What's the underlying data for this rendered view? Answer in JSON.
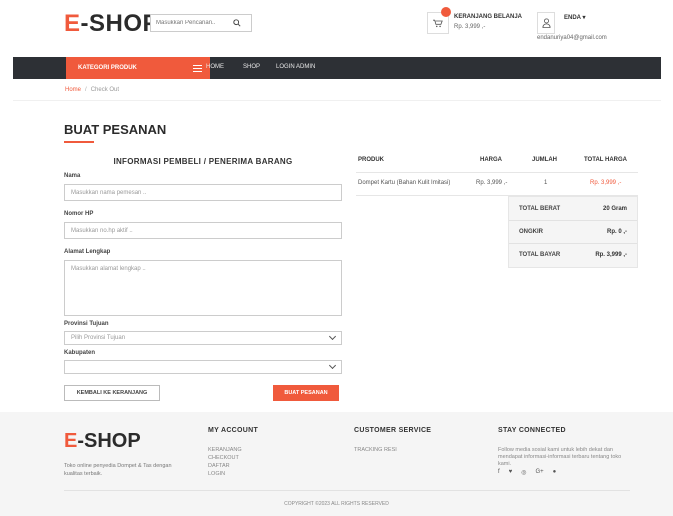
{
  "brand": {
    "prefix": "E",
    "suffix": "-SHOP",
    "accent": "#f05a3c",
    "dark": "#2d3035"
  },
  "search": {
    "placeholder": "Masukkan Pencarian..",
    "icon": "search-icon"
  },
  "cart": {
    "title": "KERANJANG BELANJA",
    "price": "Rp. 3,999 ,-",
    "icon": "cart-icon"
  },
  "user": {
    "name": "ENDA",
    "email": "endanuriya04@gmail.com",
    "icon": "user-icon"
  },
  "nav": {
    "category_label": "KATEGORI PRODUK",
    "links": [
      "HOME",
      "SHOP",
      "LOGIN ADMIN"
    ]
  },
  "breadcrumb": {
    "home": "Home",
    "separator": "/",
    "current": "Check Out"
  },
  "page": {
    "title": "BUAT PESANAN"
  },
  "form": {
    "heading": "INFORMASI PEMBELI / PENERIMA BARANG",
    "name_label": "Nama",
    "name_placeholder": "Masukkan nama pemesan ..",
    "phone_label": "Nomor HP",
    "phone_placeholder": "Masukkan no.hp aktif ..",
    "address_label": "Alamat Lengkap",
    "address_placeholder": "Masukkan alamat lengkap ..",
    "province_label": "Provinsi Tujuan",
    "province_value": "Pilih Provinsi Tujuan",
    "city_label": "Kabupaten",
    "city_value": "",
    "back_button": "KEMBALI KE KERANJANG",
    "order_button": "BUAT PESANAN"
  },
  "table": {
    "headers": [
      "PRODUK",
      "HARGA",
      "JUMLAH",
      "TOTAL HARGA"
    ],
    "rows": [
      {
        "product": "Dompet Kartu (Bahan Kulit Imitasi)",
        "price": "Rp. 3,999 ,-",
        "qty": "1",
        "total": "Rp. 3,999 ,-"
      }
    ],
    "summary": {
      "weight_label": "TOTAL BERAT",
      "weight_value": "20 Gram",
      "shipping_label": "ONGKIR",
      "shipping_value": "Rp. 0 ,-",
      "pay_label": "TOTAL BAYAR",
      "pay_value": "Rp. 3,999 ,-"
    }
  },
  "footer": {
    "description": "Toko online penyedia Dompet & Tas dengan kualitas terbaik.",
    "account_title": "MY ACCOUNT",
    "account_links": [
      "KERANJANG",
      "CHECKOUT",
      "DAFTAR",
      "LOGIN"
    ],
    "service_title": "CUSTOMER SERVICE",
    "service_links": [
      "TRACKING RESI"
    ],
    "connect_title": "STAY CONNECTED",
    "connect_text": "Follow media sosial kami untuk lebih dekat dan mendapat informasi-informasi terbaru tentang toko kami.",
    "socials": [
      "f",
      "t",
      "ig",
      "G+",
      "p"
    ],
    "copyright": "COPYRIGHT ©2023 ALL RIGHTS RESERVED"
  }
}
